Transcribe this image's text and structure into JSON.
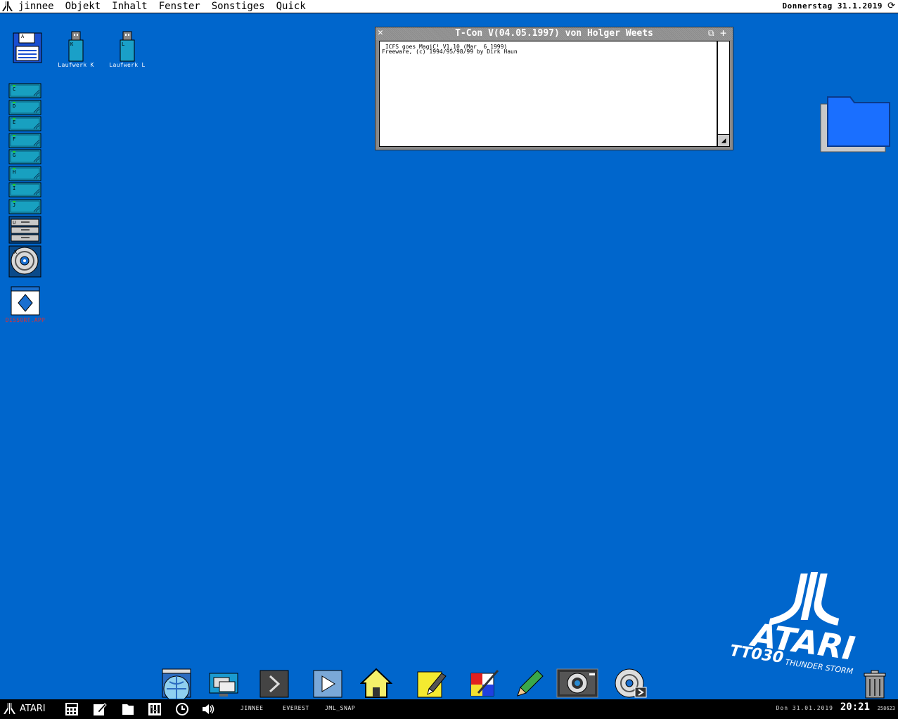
{
  "menubar": {
    "items": [
      "jinnee",
      "Objekt",
      "Inhalt",
      "Fenster",
      "Sonstiges",
      "Quick"
    ],
    "date": "Donnerstag 31.1.2019"
  },
  "desktop": {
    "floppy_letter": "A",
    "usb_drives": [
      {
        "letter": "K",
        "label": "Laufwerk K"
      },
      {
        "letter": "L",
        "label": "Laufwerk L"
      }
    ],
    "drives": [
      "C",
      "D",
      "E",
      "F",
      "G",
      "H",
      "I",
      "J"
    ],
    "archive_letter": "U",
    "cd_letter": "X",
    "app_label": "DISSORT.APP"
  },
  "window": {
    "title": "T-Con V(04.05.1997) von Holger Weets",
    "lines": [
      " ICFS goes MagiC! V1.10 (Mar  6 1999)",
      "Freeware, (c) 1994/95/98/99 by Dirk Haun"
    ]
  },
  "taskbar": {
    "start_label": "ATARI",
    "apps": [
      "JINNEE",
      "EVEREST",
      "JML_SNAP"
    ],
    "date": "Don  31.01.2019",
    "time": "20:21",
    "memory": "258623"
  },
  "logo": {
    "brand": "ATARI",
    "model": "TT030",
    "subtitle": "THUNDER STORM"
  },
  "colors": {
    "desktop": "#0066cc",
    "drive": "#18a0c0",
    "folder": "#1a6fff"
  }
}
